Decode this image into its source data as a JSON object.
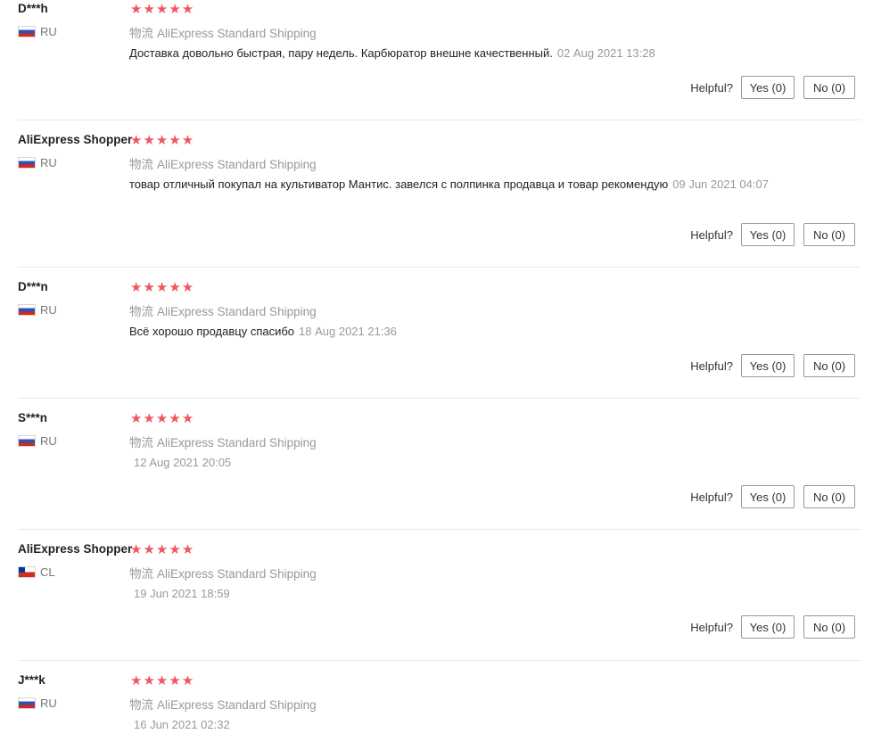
{
  "reviews": [
    {
      "user": "D***h",
      "country": "RU",
      "flag": "ru",
      "stars": "★★★★★",
      "shipping_cn": "物流",
      "shipping": "AliExpress Standard Shipping",
      "text": "Доставка довольно быстрая, пару недель. Карбюратор внешне качественный.",
      "date": "02 Aug 2021 13:28",
      "helpful": "Helpful?",
      "yes": "Yes (0)",
      "no": "No (0)"
    },
    {
      "user": "AliExpress Shopper",
      "country": "RU",
      "flag": "ru",
      "stars": "★★★★★",
      "shipping_cn": "物流",
      "shipping": "AliExpress Standard Shipping",
      "text": "товар отличный покупал на культиватор Мантис. завелся с полпинка продавца и товар рекомендую",
      "date": "09 Jun 2021 04:07",
      "helpful": "Helpful?",
      "yes": "Yes (0)",
      "no": "No (0)"
    },
    {
      "user": "D***n",
      "country": "RU",
      "flag": "ru",
      "stars": "★★★★★",
      "shipping_cn": "物流",
      "shipping": "AliExpress Standard Shipping",
      "text": "Всё хорошо продавцу спасибо",
      "date": "18 Aug 2021 21:36",
      "helpful": "Helpful?",
      "yes": "Yes (0)",
      "no": "No (0)"
    },
    {
      "user": "S***n",
      "country": "RU",
      "flag": "ru",
      "stars": "★★★★★",
      "shipping_cn": "物流",
      "shipping": "AliExpress Standard Shipping",
      "text": "",
      "date": "12 Aug 2021 20:05",
      "helpful": "Helpful?",
      "yes": "Yes (0)",
      "no": "No (0)"
    },
    {
      "user": "AliExpress Shopper",
      "country": "CL",
      "flag": "cl",
      "stars": "★★★★★",
      "shipping_cn": "物流",
      "shipping": "AliExpress Standard Shipping",
      "text": "",
      "date": "19 Jun 2021 18:59",
      "helpful": "Helpful?",
      "yes": "Yes (0)",
      "no": "No (0)"
    },
    {
      "user": "J***k",
      "country": "RU",
      "flag": "ru",
      "stars": "★★★★★",
      "shipping_cn": "物流",
      "shipping": "AliExpress Standard Shipping",
      "text": "",
      "date": "16 Jun 2021 02:32",
      "helpful": null,
      "yes": null,
      "no": null
    }
  ]
}
